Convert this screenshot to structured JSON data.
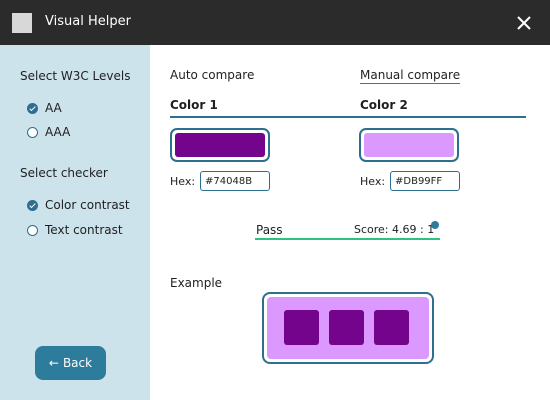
{
  "app": {
    "title": "Visual Helper",
    "icon": "app-icon",
    "close_icon": "close-icon"
  },
  "sidebar": {
    "levels_heading": "Select W3C Levels",
    "levels": [
      {
        "label": "AA",
        "checked": true
      },
      {
        "label": "AAA",
        "checked": false
      }
    ],
    "checker_heading": "Select checker",
    "checkers": [
      {
        "label": "Color contrast",
        "checked": true
      },
      {
        "label": "Text contrast",
        "checked": false
      }
    ],
    "back_label": "Back",
    "back_icon": "arrow-left-icon"
  },
  "main": {
    "mode_tabs": {
      "auto": "Auto compare",
      "manual": "Manual compare",
      "active": "manual"
    },
    "color1": {
      "header": "Color 1",
      "hex_label": "Hex:",
      "hex_value": "#74048B"
    },
    "color2": {
      "header": "Color 2",
      "hex_label": "Hex:",
      "hex_value": "#DB99FF"
    },
    "result": {
      "status": "Pass",
      "score": "Score: 4.69 : 1",
      "info_icon": "info-icon"
    },
    "example_label": "Example"
  },
  "colors": {
    "title_bar": "#2b2b2b",
    "sidebar": "#cde3ec",
    "accent": "#2d7c9b",
    "pass_line": "#2ec27e",
    "foreground": "#74048B",
    "background": "#DB99FF"
  }
}
